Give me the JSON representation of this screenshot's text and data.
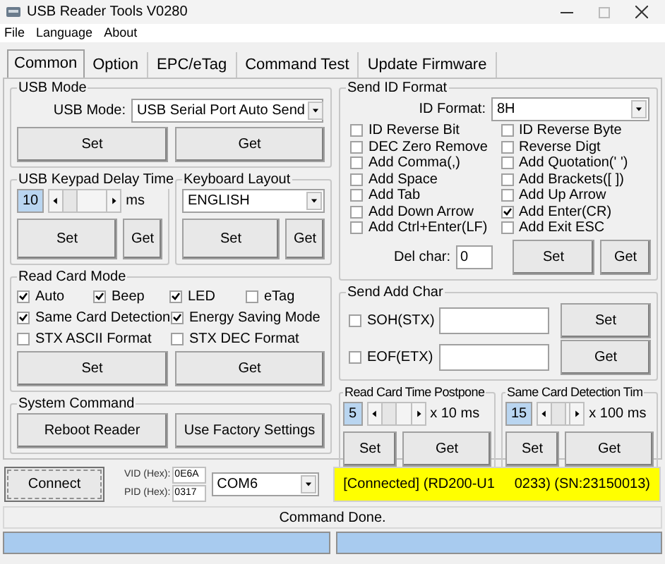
{
  "window": {
    "title": "USB Reader Tools V0280"
  },
  "menu": [
    "File",
    "Language",
    "About"
  ],
  "tabs": [
    {
      "label": "Common",
      "selected": true
    },
    {
      "label": "Option",
      "selected": false
    },
    {
      "label": "EPC/eTag",
      "selected": false
    },
    {
      "label": "Command Test",
      "selected": false
    },
    {
      "label": "Update Firmware",
      "selected": false
    }
  ],
  "usb_mode": {
    "title": "USB Mode",
    "label": "USB Mode:",
    "value": "USB Serial Port Auto Send",
    "buttons": [
      "Set",
      "Get"
    ]
  },
  "keypad_delay": {
    "title": "USB Keypad Delay Time",
    "value": "10",
    "unit": "ms",
    "buttons": [
      "Set",
      "Get"
    ]
  },
  "keyboard_layout": {
    "title": "Keyboard Layout",
    "value": "ENGLISH",
    "buttons": [
      "Set",
      "Get"
    ]
  },
  "read_card_mode": {
    "title": "Read Card Mode",
    "lines": [
      [
        {
          "label": "Auto",
          "checked": true
        },
        {
          "label": "Beep",
          "checked": true
        },
        {
          "label": "LED",
          "checked": true
        },
        {
          "label": "eTag",
          "checked": false
        }
      ],
      [
        {
          "label": "Same Card Detection",
          "checked": true
        },
        {
          "label": "Energy Saving Mode",
          "checked": true
        }
      ],
      [
        {
          "label": "STX ASCII Format",
          "checked": false
        },
        {
          "label": "STX DEC Format",
          "checked": false
        }
      ]
    ],
    "buttons": [
      "Set",
      "Get"
    ]
  },
  "system_command": {
    "title": "System Command",
    "buttons": [
      "Reboot Reader",
      "Use Factory Settings"
    ]
  },
  "send_id_format": {
    "title": "Send ID Format",
    "label": "ID Format:",
    "value": "8H",
    "options": [
      {
        "label": "ID Reverse Bit",
        "checked": false
      },
      {
        "label": "ID Reverse Byte",
        "checked": false
      },
      {
        "label": "DEC Zero Remove",
        "checked": false
      },
      {
        "label": "Reverse Digt",
        "checked": false
      },
      {
        "label": "Add Comma(,)",
        "checked": false
      },
      {
        "label": "Add Quotation(' ')",
        "checked": false
      },
      {
        "label": "Add Space",
        "checked": false
      },
      {
        "label": "Add Brackets([ ])",
        "checked": false
      },
      {
        "label": "Add Tab",
        "checked": false
      },
      {
        "label": "Add Up Arrow",
        "checked": false
      },
      {
        "label": "Add Down Arrow",
        "checked": false
      },
      {
        "label": "Add Enter(CR)",
        "checked": true
      },
      {
        "label": "Add Ctrl+Enter(LF)",
        "checked": false
      },
      {
        "label": "Add Exit ESC",
        "checked": false
      }
    ],
    "del_char_label": "Del char:",
    "del_char_value": "0",
    "buttons": [
      "Set",
      "Get"
    ]
  },
  "send_add_char": {
    "title": "Send Add Char",
    "rows": [
      {
        "label": "SOH(STX)",
        "checked": false,
        "button": "Set"
      },
      {
        "label": "EOF(ETX)",
        "checked": false,
        "button": "Get"
      }
    ]
  },
  "read_card_time": {
    "title": "Read Card Time Postpone",
    "value": "5",
    "unit": "x 10 ms",
    "buttons": [
      "Set",
      "Get"
    ]
  },
  "same_card_time": {
    "title": "Same Card Detection Tim",
    "value": "15",
    "unit": "x 100 ms",
    "buttons": [
      "Set",
      "Get"
    ]
  },
  "connection": {
    "button": "Connect",
    "vid_label": "VID (Hex):",
    "vid": "0E6A",
    "pid_label": "PID (Hex):",
    "pid": "0317",
    "port": "COM6",
    "status": "[Connected] (RD200-U1     0233) (SN:23150013)"
  },
  "status_bar": "Command Done."
}
